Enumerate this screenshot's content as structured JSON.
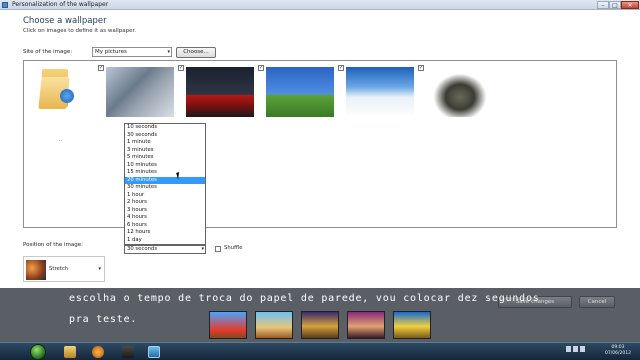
{
  "window": {
    "title": "Personalization of the wallpaper",
    "min_label": "–",
    "max_label": "□",
    "close_label": "✕"
  },
  "main": {
    "heading": "Choose a wallpaper",
    "subheading": "Click on images to define it as wallpaper.",
    "site_label": "Site of the image:",
    "site_value": "My pictures",
    "browse_label": "Choose...",
    "folder_caption": "..",
    "thumbnails": [
      {
        "name": "road-car",
        "checked": true
      },
      {
        "name": "red-sports-car",
        "checked": true
      },
      {
        "name": "rain-field",
        "checked": true
      },
      {
        "name": "snow-mountains",
        "checked": true
      },
      {
        "name": "suv",
        "checked": true
      }
    ],
    "interval_options": [
      "10 seconds",
      "30 seconds",
      "1 minute",
      "3 minutes",
      "5 minutes",
      "10 minutes",
      "15 minutes",
      "20 minutes",
      "30 minutes",
      "1 hour",
      "2 hours",
      "3 hours",
      "4 hours",
      "6 hours",
      "12 hours",
      "1 day"
    ],
    "interval_selected_index": 7,
    "interval_value": "30 seconds",
    "shuffle_label": "Shuffle",
    "shuffle_checked": false,
    "position_label": "Position of the image:",
    "position_value": "Stretch"
  },
  "caption": {
    "line1": "escolha o tempo de troca do papel de parede, vou colocar dez segundos",
    "line2": "pra teste."
  },
  "footer": {
    "save_label": "Save changes",
    "cancel_label": "Cancel"
  },
  "taskbar": {
    "time": "09:03",
    "date": "07/06/2012"
  },
  "colors": {
    "selection": "#3399ff",
    "heading": "#1e395b",
    "caption_band": "#5a5f66"
  }
}
